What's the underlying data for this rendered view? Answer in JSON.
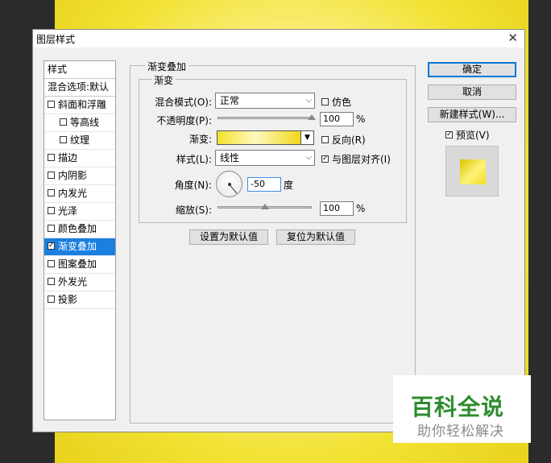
{
  "window": {
    "title": "图层样式",
    "close": "✕"
  },
  "left_panel": {
    "header": "样式",
    "blend_options": "混合选项:默认",
    "items": [
      {
        "label": "斜面和浮雕",
        "checked": false
      },
      {
        "label": "等高线",
        "checked": false,
        "sub": true
      },
      {
        "label": "纹理",
        "checked": false,
        "sub": true
      },
      {
        "label": "描边",
        "checked": false
      },
      {
        "label": "内阴影",
        "checked": false
      },
      {
        "label": "内发光",
        "checked": false
      },
      {
        "label": "光泽",
        "checked": false
      },
      {
        "label": "颜色叠加",
        "checked": false
      },
      {
        "label": "渐变叠加",
        "checked": true,
        "active": true
      },
      {
        "label": "图案叠加",
        "checked": false
      },
      {
        "label": "外发光",
        "checked": false
      },
      {
        "label": "投影",
        "checked": false
      }
    ]
  },
  "gradient_overlay": {
    "group_title": "渐变叠加",
    "subgroup_title": "渐变",
    "blend_mode_label": "混合模式(O):",
    "blend_mode_value": "正常",
    "dither_label": "仿色",
    "dither_checked": false,
    "opacity_label": "不透明度(P):",
    "opacity_value": "100",
    "opacity_unit": "%",
    "opacity_level": 1.0,
    "gradient_label": "渐变:",
    "reverse_label": "反向(R)",
    "reverse_checked": false,
    "style_label": "样式(L):",
    "style_value": "线性",
    "align_label": "与图层对齐(I)",
    "align_checked": true,
    "angle_label": "角度(N):",
    "angle_value": "-50",
    "angle_unit": "度",
    "scale_label": "缩放(S):",
    "scale_value": "100",
    "scale_unit": "%",
    "scale_level": 0.5,
    "set_default_label": "设置为默认值",
    "reset_default_label": "复位为默认值"
  },
  "buttons": {
    "ok": "确定",
    "cancel": "取消",
    "new_style": "新建样式(W)...",
    "preview_label": "预览(V)",
    "preview_checked": true
  },
  "watermark": {
    "title": "百科全说",
    "subtitle": "助你轻松解决"
  },
  "colors": {
    "accent": "#1a7fe0",
    "gradient_yellow": "#f3e22a",
    "watermark_green": "#2e8b2e"
  }
}
